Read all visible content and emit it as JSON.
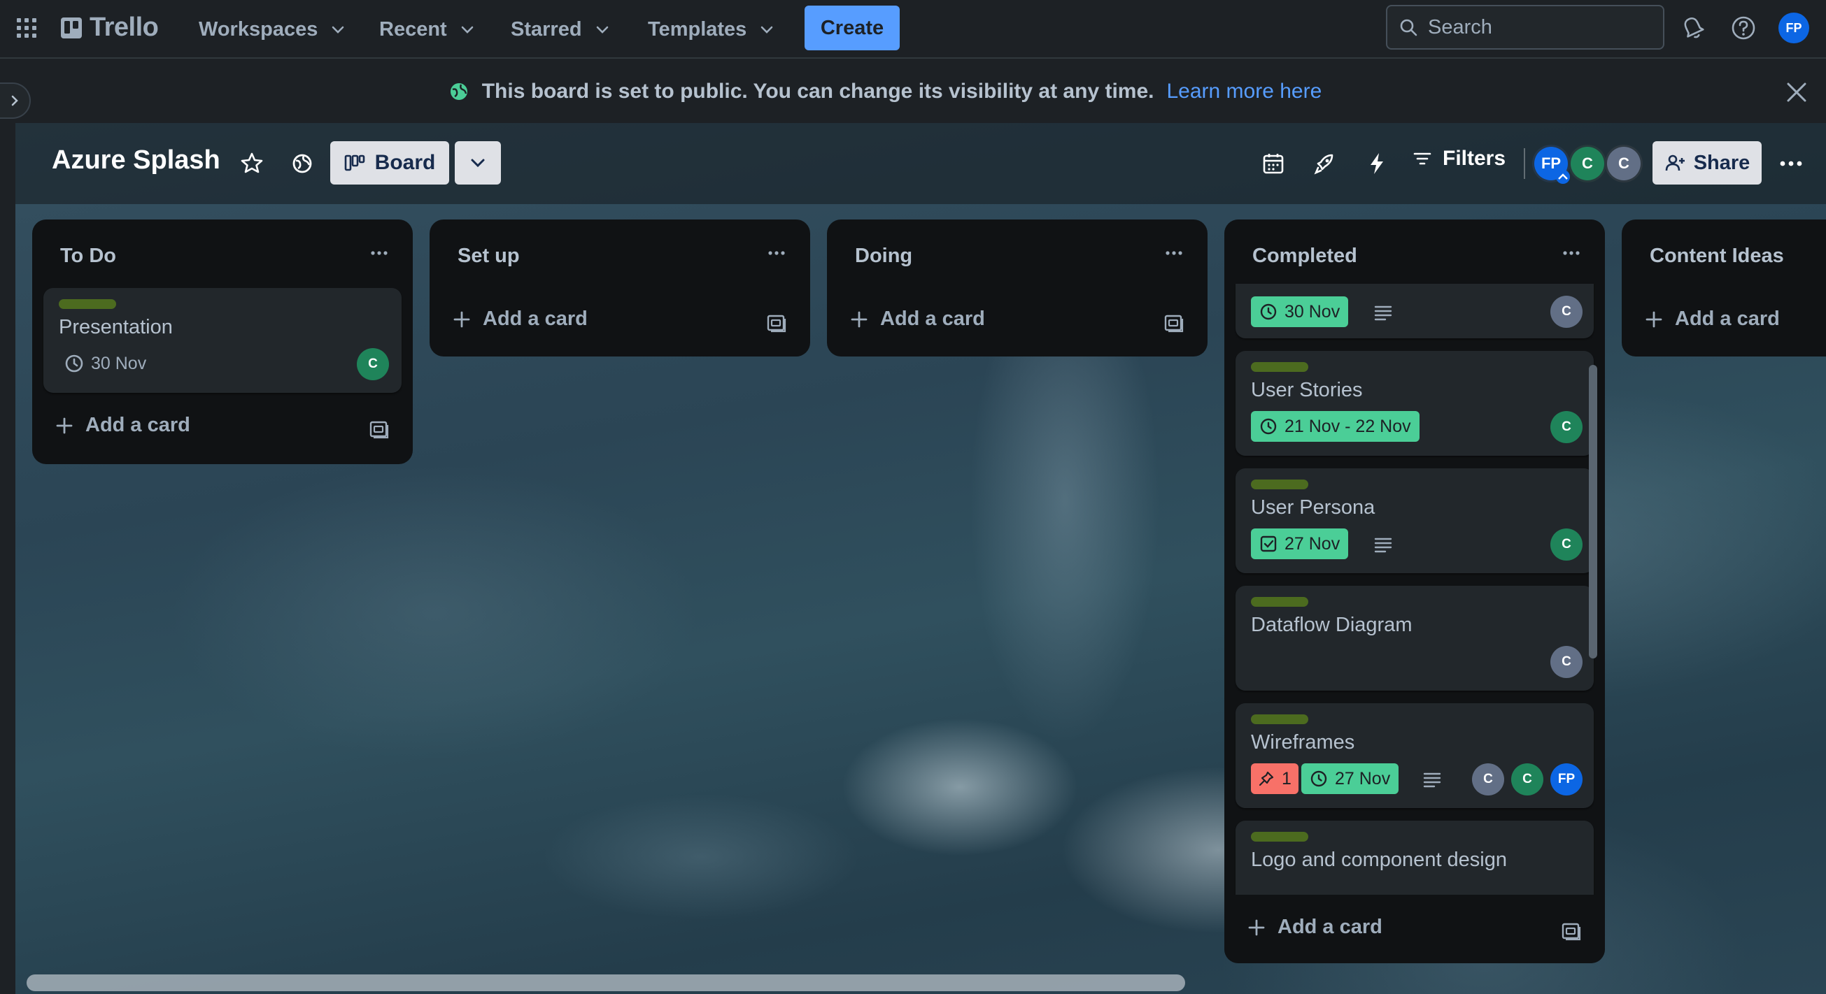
{
  "nav": {
    "logo_text": "Trello",
    "menus": [
      "Workspaces",
      "Recent",
      "Starred",
      "Templates"
    ],
    "create_label": "Create",
    "search_placeholder": "Search",
    "user_initials": "FP"
  },
  "banner": {
    "message": "This board is set to public. You can change its visibility at any time.",
    "link": "Learn more here"
  },
  "board": {
    "title": "Azure Splash",
    "view_label": "Board",
    "filters_label": "Filters",
    "share_label": "Share",
    "members": [
      {
        "initials": "FP",
        "color": "#0c66e4"
      },
      {
        "initials": "C",
        "color": "#1f845a"
      },
      {
        "initials": "C",
        "color": "#626f86"
      }
    ]
  },
  "lists": [
    {
      "title": "To Do",
      "add_label": "Add a card",
      "cards": [
        {
          "title": "Presentation",
          "label_color": "#4c6b1f",
          "date": "30 Nov",
          "date_style": "plain",
          "members": [
            "C"
          ]
        }
      ]
    },
    {
      "title": "Set up",
      "add_label": "Add a card",
      "cards": []
    },
    {
      "title": "Doing",
      "add_label": "Add a card",
      "cards": []
    },
    {
      "title": "Completed",
      "add_label": "Add a card",
      "cards": [
        {
          "title": "",
          "date": "30 Nov",
          "date_style": "green",
          "has_description": true,
          "members": [
            "C"
          ]
        },
        {
          "title": "User Stories",
          "label_color": "#4c6b1f",
          "date": "21 Nov - 22 Nov",
          "date_style": "green",
          "members": [
            "C"
          ]
        },
        {
          "title": "User Persona",
          "label_color": "#4c6b1f",
          "date": "27 Nov",
          "date_style": "green",
          "has_description": true,
          "members": [
            "C"
          ]
        },
        {
          "title": "Dataflow Diagram",
          "label_color": "#4c6b1f",
          "members": [
            "C"
          ]
        },
        {
          "title": "Wireframes",
          "label_color": "#4c6b1f",
          "red_badge": "1",
          "date": "27 Nov",
          "date_style": "green",
          "has_description": true,
          "members": [
            "C",
            "C",
            "FP"
          ]
        },
        {
          "title": "Logo and component design",
          "label_color": "#4c6b1f"
        }
      ]
    },
    {
      "title": "Content Ideas",
      "add_label": "Add a card",
      "cards": []
    }
  ]
}
